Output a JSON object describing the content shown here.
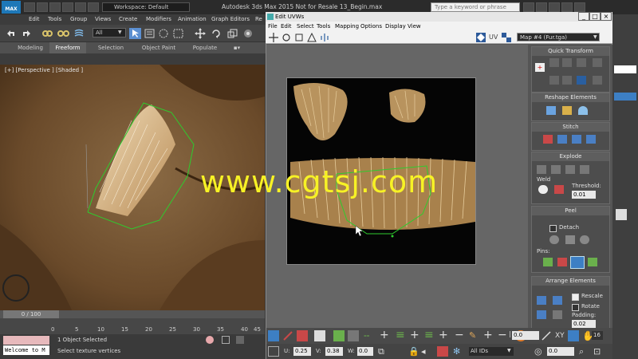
{
  "app": {
    "logo": "MAX",
    "workspace": "Workspace: Default",
    "title": "Autodesk 3ds Max  2015    Not for Resale    13_Begin.max",
    "search_placeholder": "Type a keyword or phrase"
  },
  "menu": [
    "Edit",
    "Tools",
    "Group",
    "Views",
    "Create",
    "Modifiers",
    "Animation",
    "Graph Editors",
    "Re"
  ],
  "toolbar": {
    "selection_filter": "All"
  },
  "ribbon": {
    "tabs": [
      "Modeling",
      "Freeform",
      "Selection",
      "Object Paint",
      "Populate"
    ],
    "active_tab": "Freeform"
  },
  "viewport": {
    "label": "[+] [Perspective ] [Shaded ]"
  },
  "timeline": {
    "frame": "0 / 100",
    "ticks": [
      "0",
      "5",
      "10",
      "15",
      "20",
      "25",
      "30",
      "35",
      "40",
      "45"
    ]
  },
  "status": {
    "maxscript": "Welcome to M",
    "selection": "1 Object Selected",
    "prompt": "Select texture vertices"
  },
  "uvw": {
    "title": "Edit UVWs",
    "menu": [
      "File",
      "Edit",
      "Select",
      "Tools",
      "Mapping",
      "Options",
      "Display",
      "View"
    ],
    "uv_label": "UV",
    "map": "Map #4 (Fur.tga)",
    "panel": {
      "quick_transform": "Quick Transform",
      "reshape": "Reshape Elements",
      "stitch": "Stitch",
      "explode": "Explode",
      "weld": "Weld",
      "threshold_label": "Threshold:",
      "threshold": "0.01",
      "peel": "Peel",
      "detach": "Detach",
      "pins": "Pins:",
      "arrange": "Arrange Elements",
      "rescale": "Rescale",
      "rotate": "Rotate",
      "padding_label": "Padding:",
      "padding": "0.02"
    },
    "bottom": {
      "value_a": "0.0",
      "value_b": "0.0",
      "xy": "XY",
      "zoom": "16",
      "u_label": "U:",
      "u_value": "0.25",
      "v_label": "V:",
      "v_value": "0.38",
      "w_label": "W:",
      "w_value": "0.0",
      "ids": "All IDs"
    }
  },
  "watermark": "www.cgtsj.com",
  "colors": {
    "uv_edge": "#2ecc2e",
    "watermark": "#f7f225",
    "title_bg": "#2b2b2b"
  }
}
